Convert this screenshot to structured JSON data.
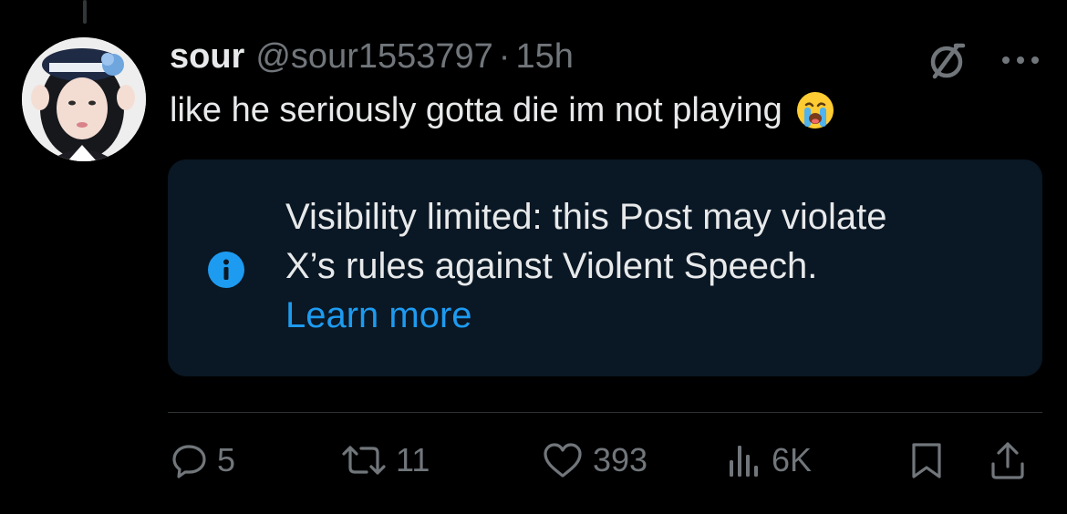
{
  "author": {
    "display_name": "sour",
    "handle": "@sour1553797",
    "separator": "·",
    "time": "15h"
  },
  "post": {
    "text": "like he seriously gotta die im not playing",
    "emoji_icon": "loudly-crying-face-icon"
  },
  "notice": {
    "line1": "Visibility limited: this Post may violate",
    "line2": "X’s rules against Violent Speech.",
    "link_label": "Learn more",
    "icon": "info-icon"
  },
  "actions": {
    "replies": "5",
    "reposts": "11",
    "likes": "393",
    "views": "6K"
  },
  "colors": {
    "background": "#000000",
    "primary_text": "#e7e9ea",
    "secondary_text": "#71767b",
    "accent": "#1d9bf0",
    "notice_bg": "#0a1724",
    "divider": "#2f3336"
  }
}
